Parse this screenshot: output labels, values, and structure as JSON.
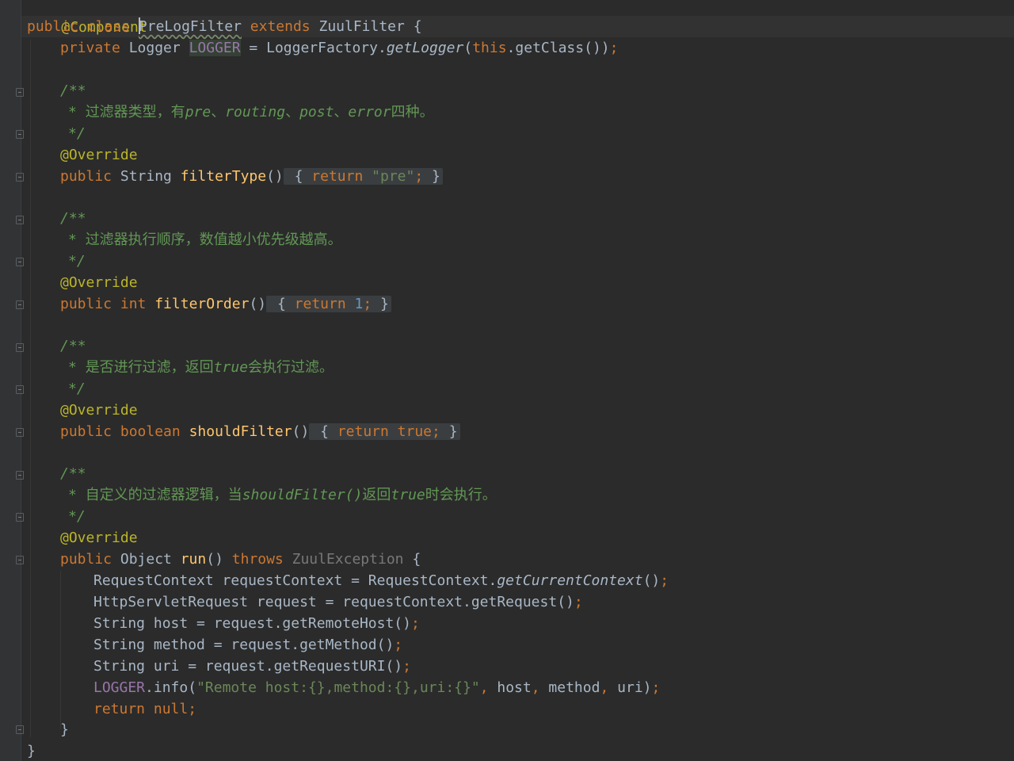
{
  "editor": {
    "language": "java",
    "lines": {
      "l0": [
        "@Component"
      ],
      "l1": [
        "public class ",
        "PreLogFilter",
        " extends ",
        "ZuulFilter {"
      ],
      "l2": [
        "private ",
        "Logger ",
        "LOGGER",
        " = LoggerFactory.",
        "getLogger",
        "(",
        "this",
        ".getClass())",
        ";"
      ],
      "l4": [
        "/**"
      ],
      "l5": [
        "* ",
        "过滤器类型，有",
        "pre",
        "、",
        "routing",
        "、",
        "post",
        "、",
        "error",
        "四种。"
      ],
      "l6": [
        "*/"
      ],
      "l7": [
        "@Override"
      ],
      "l8": [
        "public ",
        "String ",
        "filterType",
        "()",
        " { ",
        "return ",
        "\"pre\"",
        ";",
        " }"
      ],
      "l10": [
        "/**"
      ],
      "l11": [
        "* ",
        "过滤器执行顺序，数值越小优先级越高。"
      ],
      "l12": [
        "*/"
      ],
      "l13": [
        "@Override"
      ],
      "l14": [
        "public int ",
        "filterOrder",
        "()",
        " { ",
        "return ",
        "1",
        ";",
        " }"
      ],
      "l16": [
        "/**"
      ],
      "l17": [
        "* ",
        "是否进行过滤，返回",
        "true",
        "会执行过滤。"
      ],
      "l18": [
        "*/"
      ],
      "l19": [
        "@Override"
      ],
      "l20": [
        "public boolean ",
        "shouldFilter",
        "()",
        " { ",
        "return true",
        ";",
        " }"
      ],
      "l22": [
        "/**"
      ],
      "l23": [
        "* ",
        "自定义的过滤器逻辑，当",
        "shouldFilter()",
        "返回",
        "true",
        "时会执行。"
      ],
      "l24": [
        "*/"
      ],
      "l25": [
        "@Override"
      ],
      "l26": [
        "public ",
        "Object ",
        "run",
        "() ",
        "throws ",
        "ZuulException",
        " {"
      ],
      "l27": [
        "RequestContext requestContext = RequestContext.",
        "getCurrentContext",
        "()",
        ";"
      ],
      "l28": [
        "HttpServletRequest request = requestContext.getRequest()",
        ";"
      ],
      "l29": [
        "String host = request.getRemoteHost()",
        ";"
      ],
      "l30": [
        "String method = request.getMethod()",
        ";"
      ],
      "l31": [
        "String uri = request.getRequestURI()",
        ";"
      ],
      "l32": [
        "LOGGER",
        ".info(",
        "\"Remote host:{},method:{},uri:{}\"",
        ", ",
        "host",
        ", ",
        "method",
        ", ",
        "uri)",
        ";"
      ],
      "l33": [
        "return null",
        ";"
      ],
      "l34": [
        "}"
      ],
      "l35": [
        "}"
      ]
    },
    "colors": {
      "background": "#2b2b2b",
      "keyword": "#cc7832",
      "annotation": "#bbb529",
      "doc_comment": "#629755",
      "field": "#9876aa",
      "string": "#6a8759",
      "number": "#6897bb",
      "method_declaration": "#ffc66d",
      "default_text": "#a9b7c6"
    },
    "gutter_icons": {
      "fold": "fold-icon"
    }
  }
}
